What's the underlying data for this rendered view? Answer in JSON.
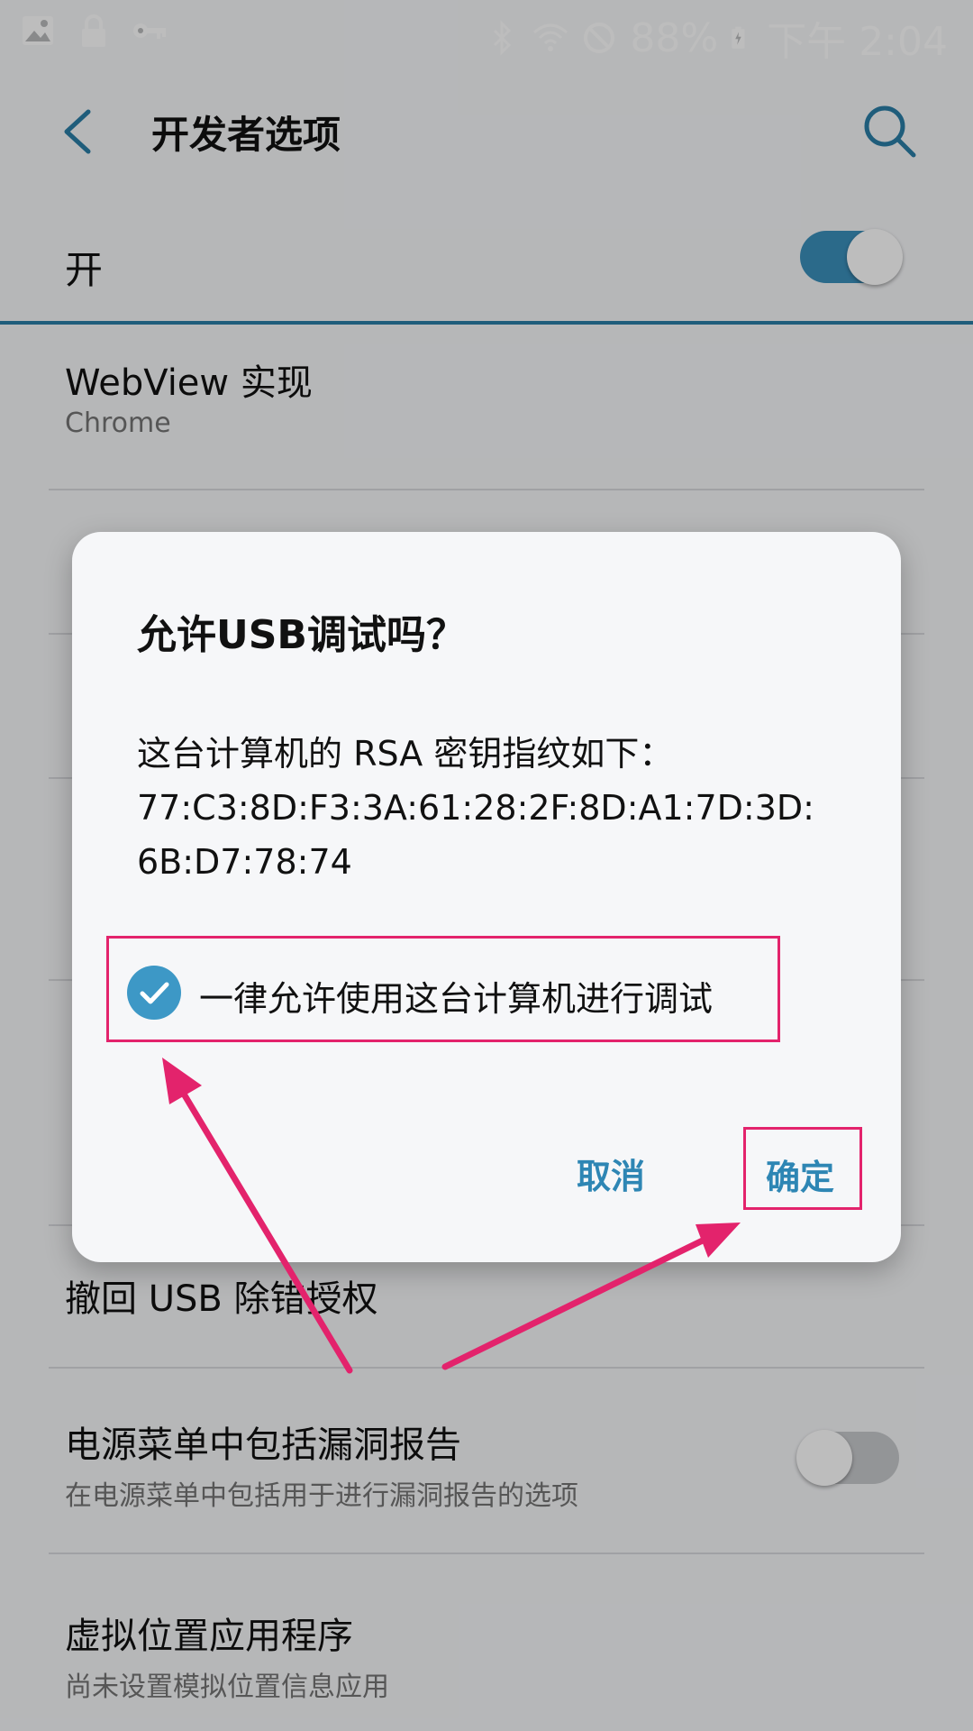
{
  "status_bar": {
    "battery": "88%",
    "time": "下午 2:04",
    "icons_left": [
      "image-icon",
      "lock-icon",
      "key-icon"
    ],
    "icons_right": [
      "bluetooth-icon",
      "wifi-icon",
      "do-not-disturb-icon",
      "battery-charging-icon"
    ]
  },
  "app_bar": {
    "title": "开发者选项",
    "back_icon": "back-arrow-icon",
    "search_icon": "search-icon"
  },
  "master_toggle": {
    "label": "开",
    "state": "on"
  },
  "list": {
    "webview": {
      "title": "WebView 实现",
      "summary": "Chrome"
    },
    "revoke": {
      "title": "撤回 USB 除错授权"
    },
    "bugreport": {
      "title": "电源菜单中包括漏洞报告",
      "summary": "在电源菜单中包括用于进行漏洞报告的选项",
      "state": "off"
    },
    "mock": {
      "title": "虚拟位置应用程序",
      "summary": "尚未设置模拟位置信息应用"
    }
  },
  "dialog": {
    "title": "允许USB调试吗？",
    "message_line1": "这台计算机的 RSA 密钥指纹如下：",
    "message_line2": "77:C3:8D:F3:3A:61:28:2F:8D:A1:7D:3D:",
    "message_line3": "6B:D7:78:74",
    "always_allow_label": "一律允许使用这台计算机进行调试",
    "always_allow_checked": true,
    "cancel_label": "取消",
    "confirm_label": "确定"
  },
  "colors": {
    "accent": "#3a8fbb",
    "annotation": "#e3236c",
    "button_text": "#2e86b4"
  }
}
